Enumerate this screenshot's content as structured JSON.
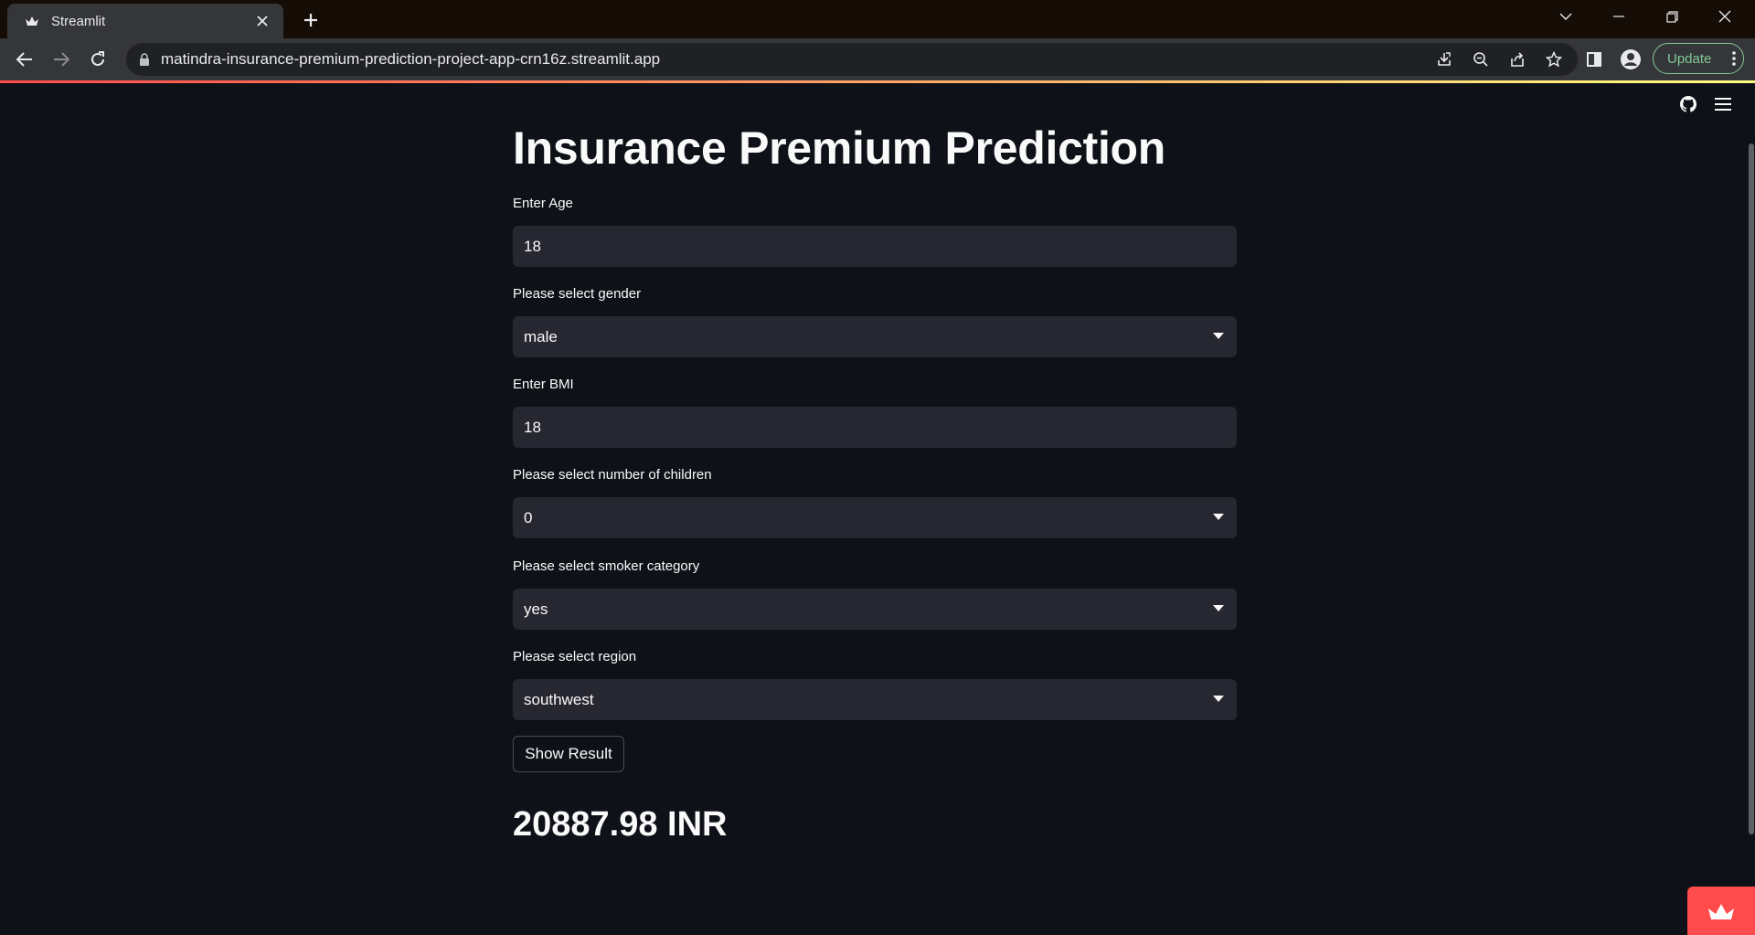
{
  "browser": {
    "tab_title": "Streamlit",
    "url": "matindra-insurance-premium-prediction-project-app-crn16z.streamlit.app",
    "update_label": "Update"
  },
  "app": {
    "title": "Insurance Premium Prediction",
    "fields": {
      "age": {
        "label": "Enter Age",
        "value": "18"
      },
      "gender": {
        "label": "Please select gender",
        "value": "male"
      },
      "bmi": {
        "label": "Enter BMI",
        "value": "18"
      },
      "children": {
        "label": "Please select number of children",
        "value": "0"
      },
      "smoker": {
        "label": "Please select smoker category",
        "value": "yes"
      },
      "region": {
        "label": "Please select region",
        "value": "southwest"
      }
    },
    "button_label": "Show Result",
    "result": "20887.98 INR"
  },
  "colors": {
    "background": "#0e1117",
    "input_bg": "#262730",
    "accent": "#ff4b4b",
    "text": "#fafafa"
  }
}
